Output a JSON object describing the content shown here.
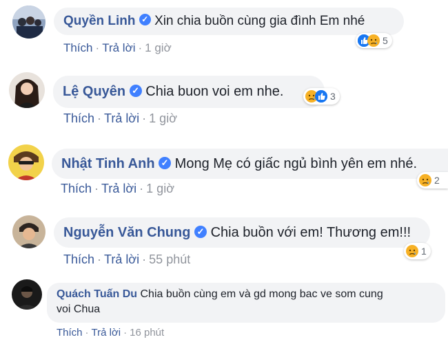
{
  "comments": [
    {
      "name": "Quyền Linh",
      "text": "Xin chia buồn cùng gia đình Em nhé",
      "like_label": "Thích",
      "reply_label": "Trả lời",
      "time": "1 giờ",
      "reaction_count": "5",
      "reactions": [
        "like-icon",
        "sad-icon"
      ]
    },
    {
      "name": "Lệ Quyên",
      "text": "Chia buon voi em nhe.",
      "like_label": "Thích",
      "reply_label": "Trả lời",
      "time": "1 giờ",
      "reaction_count": "3",
      "reactions": [
        "sad-icon",
        "like-icon"
      ]
    },
    {
      "name": "Nhật Tinh Anh",
      "text": "Mong Mẹ có giấc ngủ bình yên em nhé.",
      "like_label": "Thích",
      "reply_label": "Trả lời",
      "time": "1 giờ",
      "reaction_count": "2",
      "reactions": [
        "sad-icon"
      ]
    },
    {
      "name": "Nguyễn Văn Chung",
      "text": "Chia buồn với em! Thương em!!!",
      "like_label": "Thích",
      "reply_label": "Trả lời",
      "time": "55 phút",
      "reaction_count": "1",
      "reactions": [
        "sad-icon"
      ]
    },
    {
      "name": "Quách Tuấn Du",
      "text_line1": "Chia buồn cùng em và gd mong bac ve som cung",
      "text_line2": "voi Chua",
      "like_label": "Thích",
      "reply_label": "Trả lời",
      "time": "16 phút"
    }
  ],
  "colors": {
    "name_link": "#385898",
    "bubble_bg": "#f2f3f5",
    "meta_gray": "#90949c",
    "verified_blue": "#4080ff",
    "like_blue": "#1877f2",
    "sad_yellow": "#f7b125"
  }
}
